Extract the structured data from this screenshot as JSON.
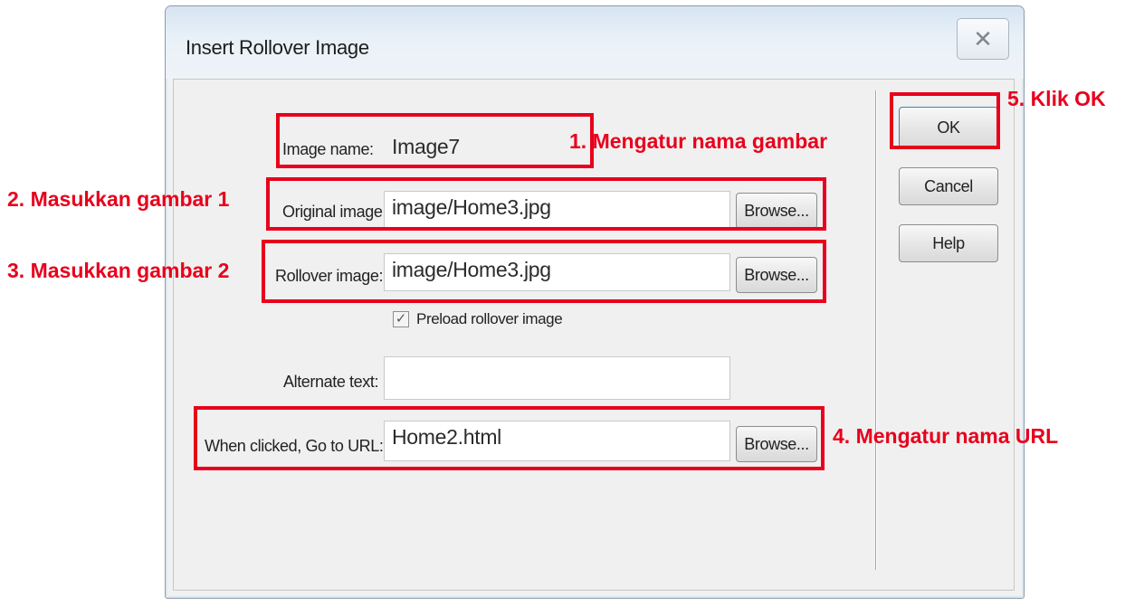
{
  "dialog": {
    "title": "Insert Rollover Image",
    "close_icon": "close-icon",
    "fields": {
      "image_name": {
        "label": "Image name:",
        "value": "Image7"
      },
      "original_image": {
        "label": "Original image:",
        "value": "image/Home3.jpg",
        "browse_label": "Browse..."
      },
      "rollover_image": {
        "label": "Rollover image:",
        "value": "image/Home3.jpg",
        "browse_label": "Browse..."
      },
      "preload": {
        "label": "Preload rollover image",
        "checked": true
      },
      "alternate_text": {
        "label": "Alternate text:",
        "value": ""
      },
      "url": {
        "label": "When clicked, Go to URL:",
        "value": "Home2.html",
        "browse_label": "Browse..."
      }
    },
    "buttons": {
      "ok": "OK",
      "cancel": "Cancel",
      "help": "Help"
    }
  },
  "annotations": {
    "step1": "1. Mengatur nama gambar",
    "step2": "2. Masukkan gambar 1",
    "step3": "3. Masukkan gambar 2",
    "step4": "4. Mengatur nama URL",
    "step5": "5. Klik OK",
    "color": "#e8001c"
  }
}
